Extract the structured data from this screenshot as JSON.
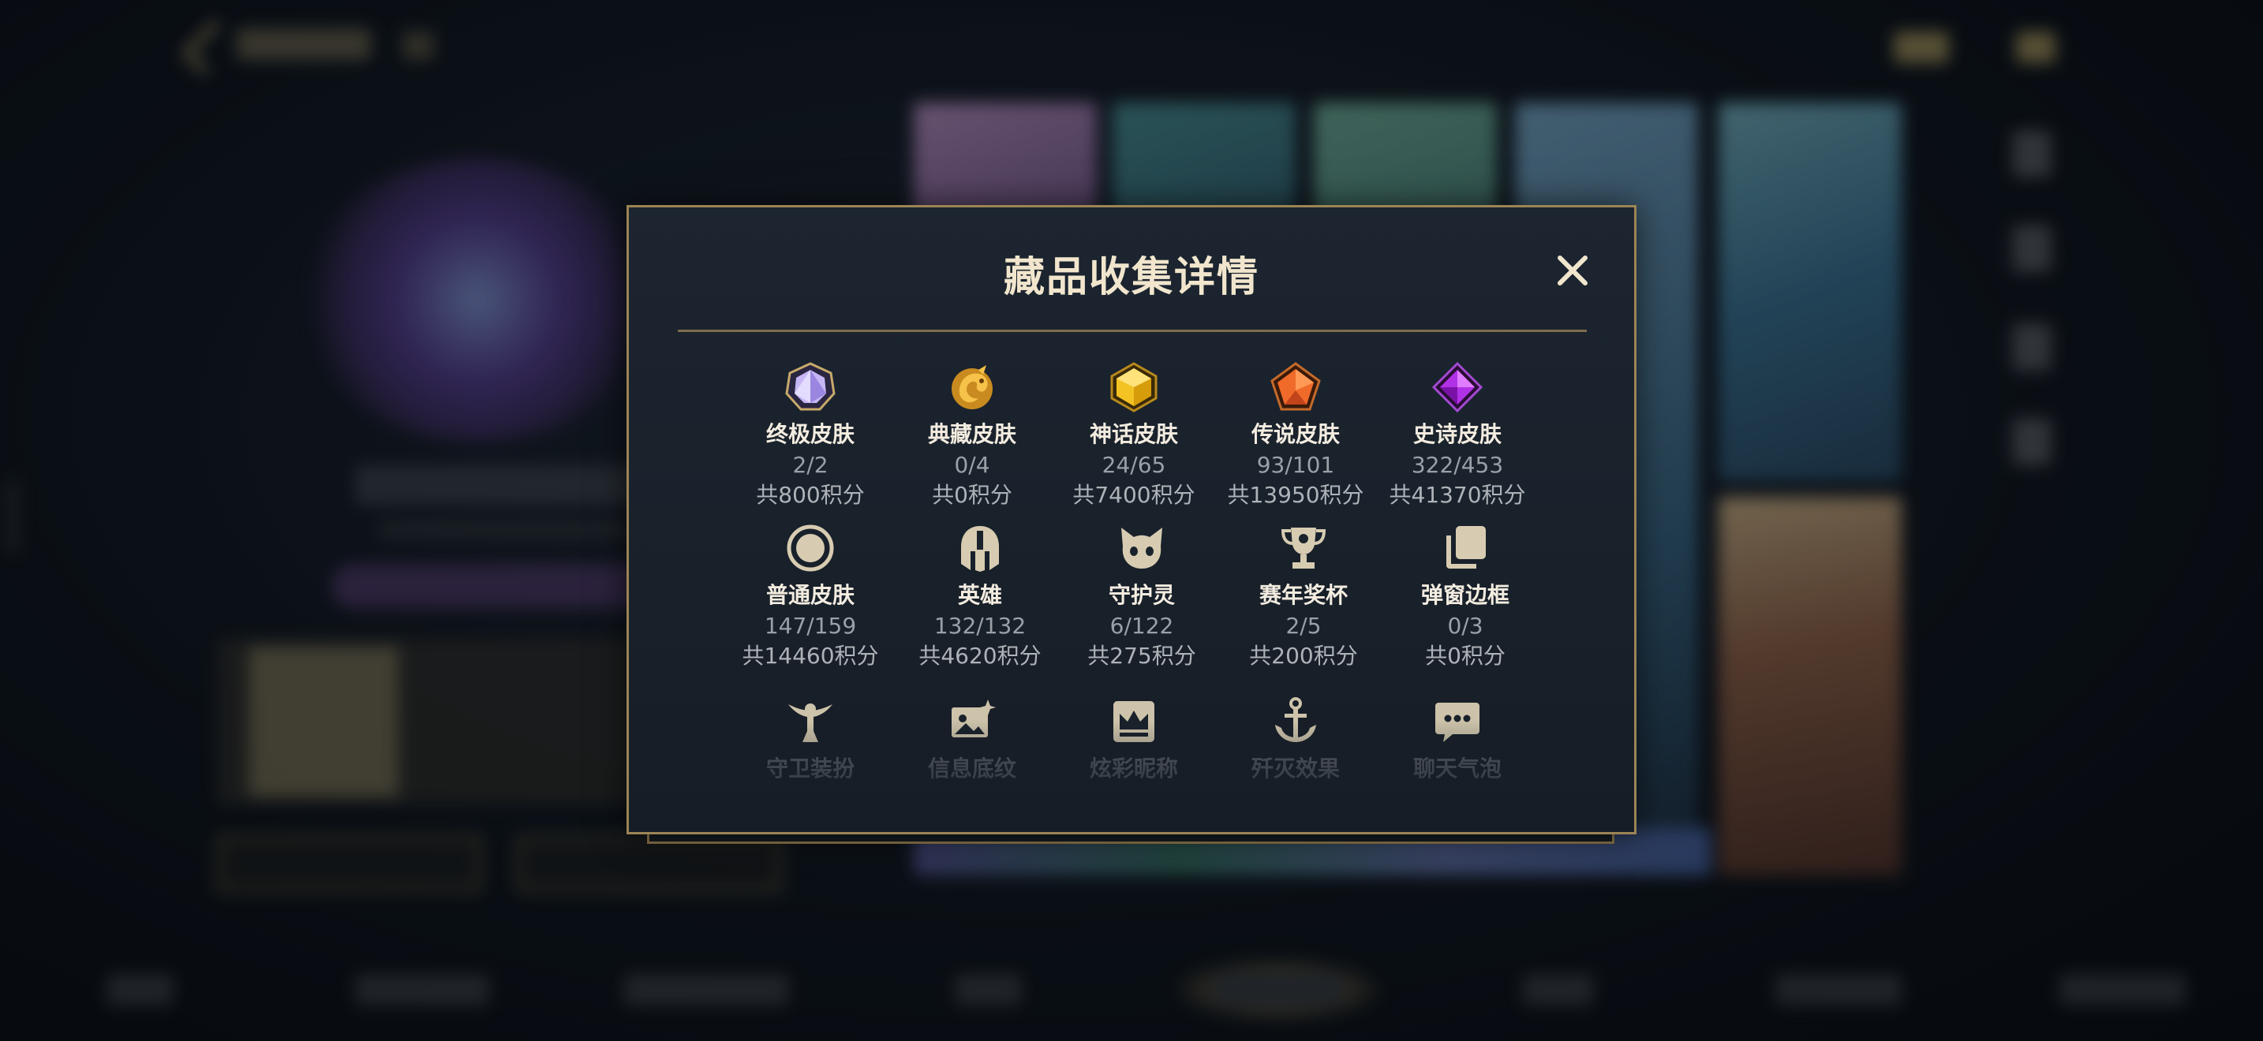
{
  "modal": {
    "title": "藏品收集详情",
    "close_label": "✕"
  },
  "collection_items": [
    {
      "name": "终极皮肤",
      "count": "2/2",
      "points": "共800积分",
      "icon": "ultimate-skin-gem-icon"
    },
    {
      "name": "典藏皮肤",
      "count": "0/4",
      "points": "共0积分",
      "icon": "prestige-skin-dragon-icon"
    },
    {
      "name": "神话皮肤",
      "count": "24/65",
      "points": "共7400积分",
      "icon": "mythic-skin-gem-icon"
    },
    {
      "name": "传说皮肤",
      "count": "93/101",
      "points": "共13950积分",
      "icon": "legendary-skin-gem-icon"
    },
    {
      "name": "史诗皮肤",
      "count": "322/453",
      "points": "共41370积分",
      "icon": "epic-skin-gem-icon"
    },
    {
      "name": "普通皮肤",
      "count": "147/159",
      "points": "共14460积分",
      "icon": "standard-skin-circle-icon"
    },
    {
      "name": "英雄",
      "count": "132/132",
      "points": "共4620积分",
      "icon": "champion-helmet-icon"
    },
    {
      "name": "守护灵",
      "count": "6/122",
      "points": "共275积分",
      "icon": "companion-creature-icon"
    },
    {
      "name": "赛年奖杯",
      "count": "2/5",
      "points": "共200积分",
      "icon": "season-trophy-icon"
    },
    {
      "name": "弹窗边框",
      "count": "0/3",
      "points": "共0积分",
      "icon": "popup-frame-stack-icon"
    },
    {
      "name": "守卫装扮",
      "icon": "ward-skin-icon"
    },
    {
      "name": "信息底纹",
      "icon": "info-banner-icon"
    },
    {
      "name": "炫彩昵称",
      "icon": "colorful-nickname-crown-icon"
    },
    {
      "name": "歼灭效果",
      "icon": "ace-effect-anchor-icon"
    },
    {
      "name": "聊天气泡",
      "icon": "chat-bubble-icon"
    }
  ],
  "colors": {
    "gold_accent": "#9c8455",
    "title_text": "#f1e6cd",
    "muted_text": "#9aa0a6",
    "modal_bg": "#1a222c"
  }
}
